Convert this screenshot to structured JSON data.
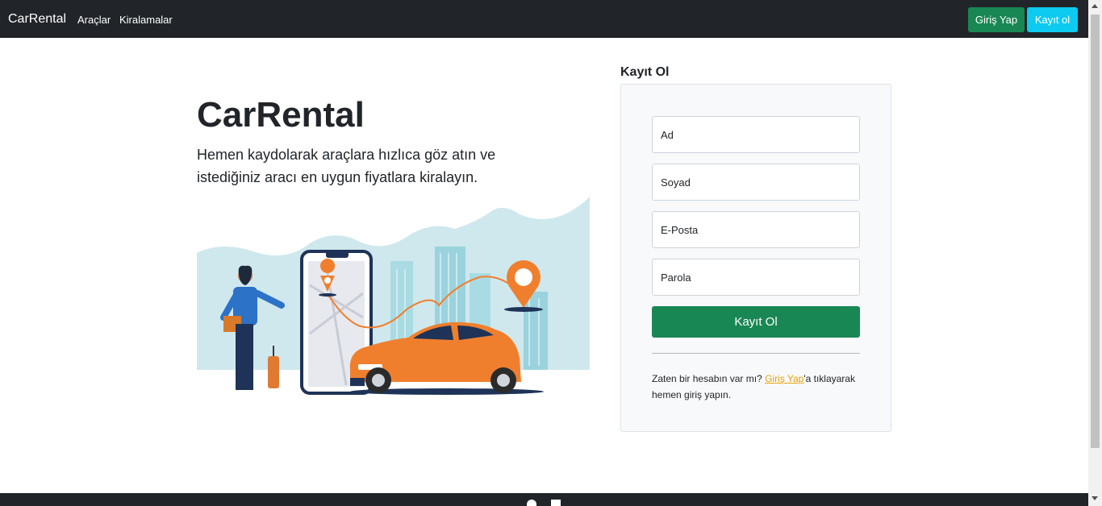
{
  "navbar": {
    "brand": "CarRental",
    "links": [
      "Araçlar",
      "Kiralamalar"
    ],
    "login_button": "Giriş Yap",
    "register_button": "Kayıt ol"
  },
  "hero": {
    "title": "CarRental",
    "description": "Hemen kaydolarak araçlara hızlıca göz atın ve istediğiniz aracı en uygun fiyatlara kiralayın."
  },
  "register": {
    "heading": "Kayıt Ol",
    "fields": [
      {
        "placeholder": "Ad",
        "value": ""
      },
      {
        "placeholder": "Soyad",
        "value": ""
      },
      {
        "placeholder": "E-Posta",
        "value": ""
      },
      {
        "placeholder": "Parola",
        "value": ""
      }
    ],
    "submit_label": "Kayıt Ol",
    "footnote_before": "Zaten bir hesabın var mı? ",
    "footnote_link": "Giriş Yap",
    "footnote_after": "'a tıklayarak hemen giriş yapın."
  },
  "footer": {
    "icons": [
      "github-icon",
      "linkedin-icon"
    ]
  },
  "colors": {
    "navbar": "#212529",
    "success": "#198754",
    "info": "#0dcaf0",
    "link": "#e6a10a",
    "car": "#f07f2d"
  }
}
